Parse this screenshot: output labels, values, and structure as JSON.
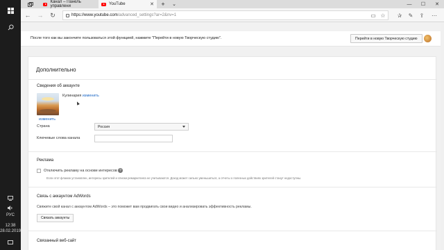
{
  "taskbar": {
    "tray": {
      "lang": "РУС",
      "time": "12:38",
      "date": "28.02.2019"
    }
  },
  "browser": {
    "tabs": [
      {
        "title": "Канал – Панель управлени"
      },
      {
        "title": "YouTube"
      }
    ],
    "url": {
      "host": "https://www.youtube.com",
      "path": "/advanced_settings?ar=2&nv=1"
    }
  },
  "notice": {
    "text": "После того как вы закончите пользоваться этой функцией, нажмите \"Перейти в новую Творческую студию\".",
    "button": "Перейти в новую Творческую студию"
  },
  "card": {
    "title": "Дополнительно",
    "account": {
      "heading": "Сведения об аккаунте",
      "name": "Кулинария",
      "change_inline": "изменить",
      "change_below": "изменить"
    },
    "country": {
      "label": "Страна",
      "value": "Россия"
    },
    "keywords": {
      "label": "Ключевые слова канала",
      "value": ""
    },
    "ads": {
      "heading": "Реклама",
      "checkbox_label": "Отключить рекламу на основе интересов",
      "hint": "Если этот флажок установлен, интересы зрителей и списки ремаркетинга не учитываются. Доход может сильно уменьшиться, а отчеты о полезных действиях зрителей станут недоступны."
    },
    "adwords": {
      "heading": "Связь с аккаунтом AdWords",
      "desc": "Свяжите свой канал с аккаунтом AdWords – это поможет вам продвигать свои видео и анализировать эффективность рекламы.",
      "button": "Связать аккаунты"
    },
    "website": {
      "heading": "Связанный веб-сайт"
    }
  }
}
